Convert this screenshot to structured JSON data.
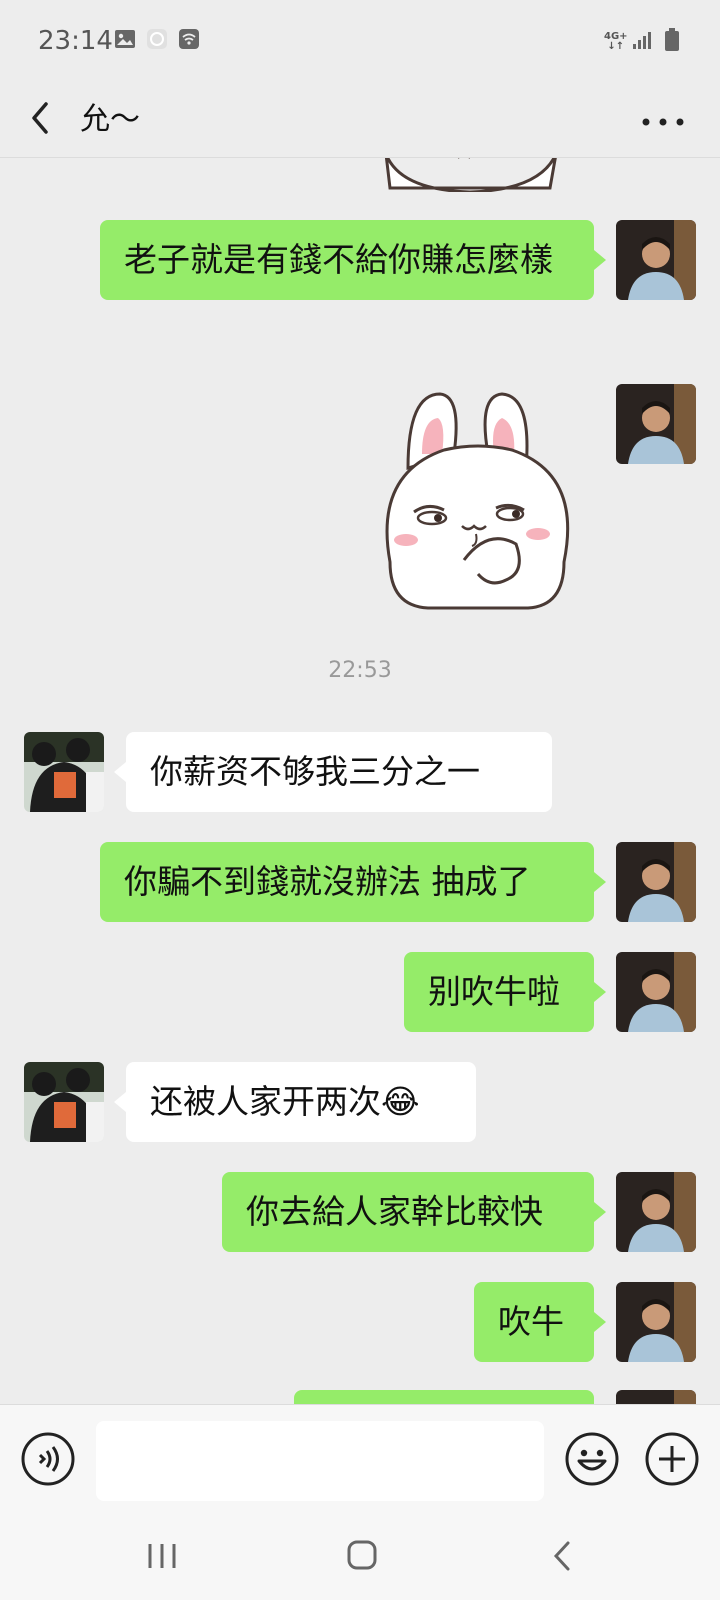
{
  "status_bar": {
    "time": "23:14",
    "network": "4G+"
  },
  "header": {
    "title": "允～"
  },
  "timestamp": "22:53",
  "messages": [
    {
      "side": "me",
      "text": "老子就是有錢不給你賺怎麼樣"
    },
    {
      "side": "me",
      "type": "sticker",
      "sticker_icon": "bunny-sticker"
    },
    {
      "side": "them",
      "text": "你薪资不够我三分之一"
    },
    {
      "side": "me",
      "text": "你騙不到錢就沒辦法 抽成了"
    },
    {
      "side": "me",
      "text": "别吹牛啦"
    },
    {
      "side": "them",
      "text": "还被人家开两次",
      "emoji": "😂"
    },
    {
      "side": "me",
      "text": "你去給人家幹比較快"
    },
    {
      "side": "me",
      "text": "吹牛"
    }
  ],
  "input_bar": {
    "value": "",
    "voice_icon": "voice-icon",
    "emoji_icon": "emoji-icon",
    "plus_icon": "plus-icon"
  },
  "colors": {
    "background": "#ededed",
    "my_bubble": "#95ec69",
    "their_bubble": "#ffffff"
  }
}
